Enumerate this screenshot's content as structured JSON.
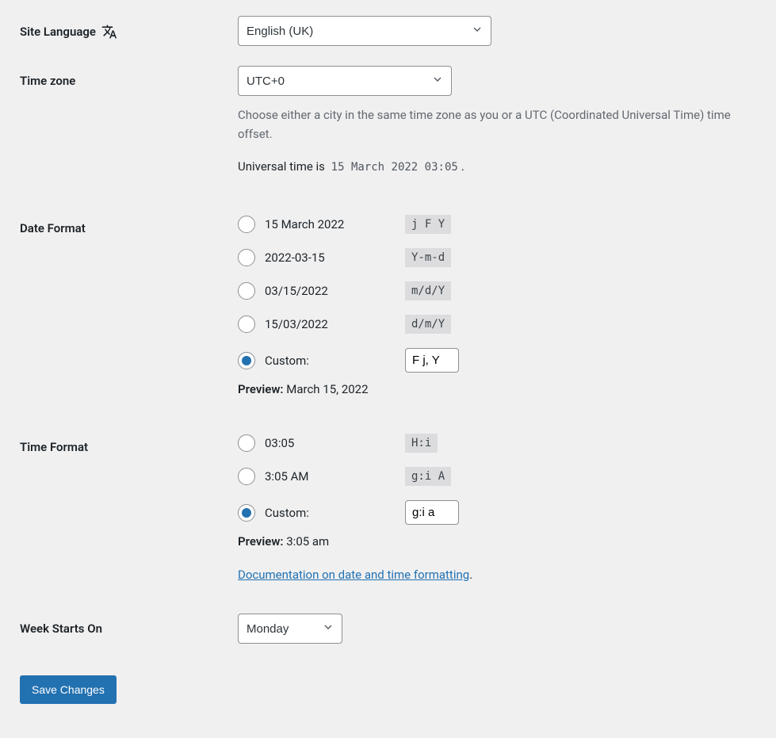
{
  "site_language": {
    "label": "Site Language",
    "value": "English (UK)"
  },
  "time_zone": {
    "label": "Time zone",
    "value": "UTC+0",
    "help": "Choose either a city in the same time zone as you or a UTC (Coordinated Universal Time) time offset.",
    "universal_text": "Universal time is",
    "universal_value": "15 March 2022 03:05",
    "period": "."
  },
  "date_format": {
    "label": "Date Format",
    "options": [
      {
        "display": "15 March 2022",
        "code": "j F Y"
      },
      {
        "display": "2022-03-15",
        "code": "Y-m-d"
      },
      {
        "display": "03/15/2022",
        "code": "m/d/Y"
      },
      {
        "display": "15/03/2022",
        "code": "d/m/Y"
      }
    ],
    "custom_label": "Custom:",
    "custom_value": "F j, Y",
    "preview_label": "Preview:",
    "preview_value": "March 15, 2022"
  },
  "time_format": {
    "label": "Time Format",
    "options": [
      {
        "display": "03:05",
        "code": "H:i"
      },
      {
        "display": "3:05 AM",
        "code": "g:i A"
      }
    ],
    "custom_label": "Custom:",
    "custom_value": "g:i a",
    "preview_label": "Preview:",
    "preview_value": "3:05 am",
    "doc_link": "Documentation on date and time formatting",
    "doc_period": "."
  },
  "week_starts": {
    "label": "Week Starts On",
    "value": "Monday"
  },
  "save_button": "Save Changes"
}
